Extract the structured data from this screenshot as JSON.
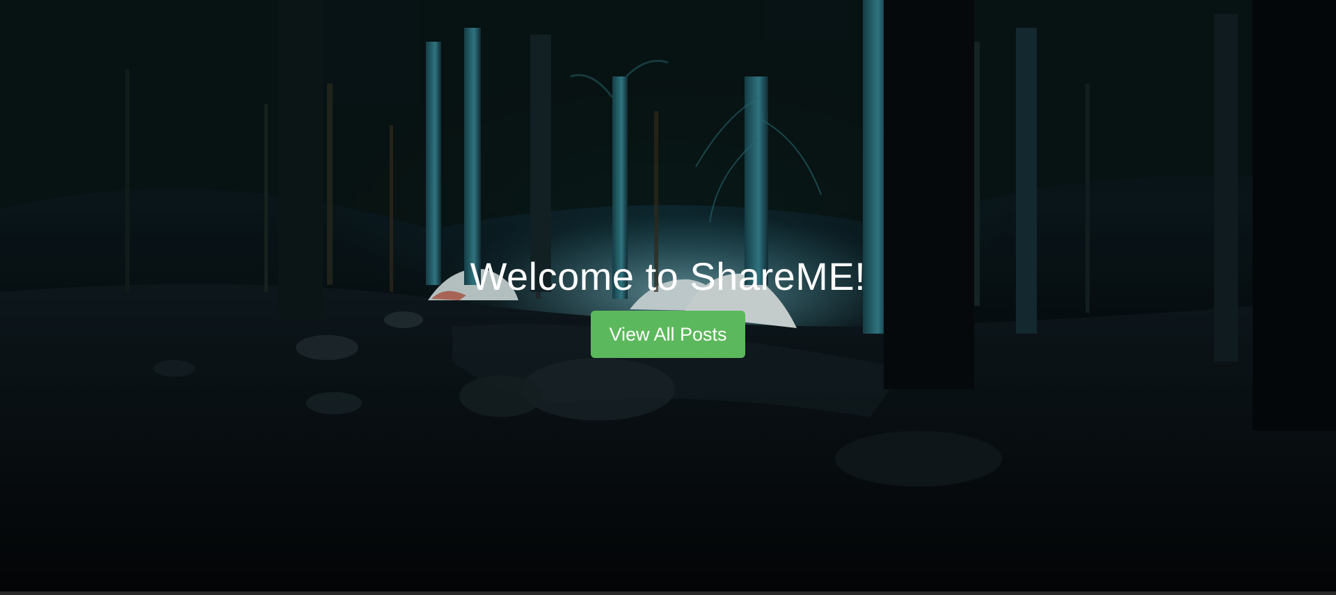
{
  "hero": {
    "title": "Welcome to ShareME!",
    "button_label": "View All Posts",
    "background": "night-forest-camping-tents-photo"
  },
  "colors": {
    "button_bg": "#5cb85c",
    "title_text": "#ffffff"
  }
}
